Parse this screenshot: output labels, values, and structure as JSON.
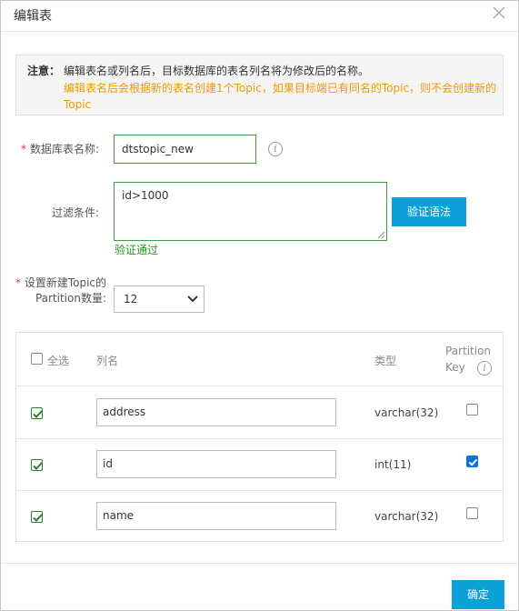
{
  "dialog": {
    "title": "编辑表"
  },
  "notice": {
    "label": "注意：",
    "line1": "编辑表名或列名后，目标数据库的表名列名将为修改后的名称。",
    "line2": "编辑表名后会根据新的表名创建1个Topic，如果目标端已有同名的Topic，则不会创建新的Topic"
  },
  "form": {
    "table_name_label": "数据库表名称:",
    "table_name_value": "dtstopic_new",
    "filter_label": "过滤条件:",
    "filter_value": "id>1000",
    "verify_button": "验证语法",
    "verify_status": "验证通过",
    "partition_label_1": "设置新建Topic的",
    "partition_label_2": "Partition数量:",
    "partition_value": "12"
  },
  "table": {
    "select_all": "全选",
    "col_name": "列名",
    "col_type": "类型",
    "col_partition_1": "Partition",
    "col_partition_2": "Key",
    "rows": [
      {
        "name": "address",
        "type": "varchar(32)",
        "selected": true,
        "partition_key": false
      },
      {
        "name": "id",
        "type": "int(11)",
        "selected": true,
        "partition_key": true
      },
      {
        "name": "name",
        "type": "varchar(32)",
        "selected": true,
        "partition_key": false
      }
    ]
  },
  "footer": {
    "confirm": "确定"
  }
}
